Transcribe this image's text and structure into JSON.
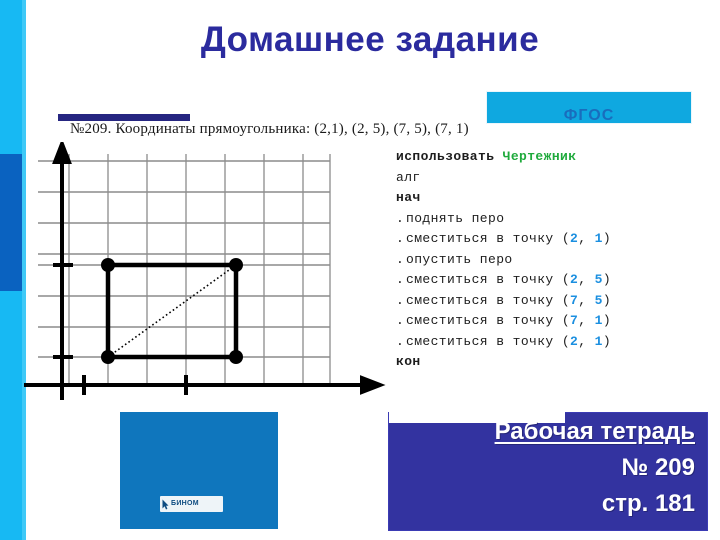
{
  "slide": {
    "title": "Домашнее задание",
    "caption": "№209. Координаты прямоугольника: (2,1), (2, 5), (7, 5), (7, 1)",
    "badge": {
      "text": "ФГОС",
      "color": "#0fa8e0"
    },
    "accent_colors": {
      "title": "#2b2b9e",
      "strip_cyan": "#17b9f3",
      "strip_dark": "#0a62c0",
      "navy_rule": "#262681",
      "panel": "#3333a0",
      "publisher_box": "#0f76bd",
      "keyword_green": "#1faa3c",
      "number_blue": "#1b8fe0"
    }
  },
  "code": {
    "lines": [
      {
        "bullet": false,
        "bold": true,
        "text": "использовать ",
        "object": "Чертежник"
      },
      {
        "bullet": false,
        "bold": false,
        "text": "алг"
      },
      {
        "bullet": false,
        "bold": true,
        "text": "нач"
      },
      {
        "bullet": true,
        "bold": false,
        "text": "поднять перо"
      },
      {
        "bullet": true,
        "bold": false,
        "text": "сместиться в точку ",
        "open": "(",
        "x": "2",
        "sep": ", ",
        "y": "1",
        "close": ")"
      },
      {
        "bullet": true,
        "bold": false,
        "text": "опустить перо"
      },
      {
        "bullet": true,
        "bold": false,
        "text": "сместиться в точку ",
        "open": "(",
        "x": "2",
        "sep": ", ",
        "y": "5",
        "close": ")"
      },
      {
        "bullet": true,
        "bold": false,
        "text": "сместиться в точку ",
        "open": "(",
        "x": "7",
        "sep": ", ",
        "y": "5",
        "close": ")"
      },
      {
        "bullet": true,
        "bold": false,
        "text": "сместиться в точку ",
        "open": "(",
        "x": "7",
        "sep": ", ",
        "y": "1",
        "close": ")"
      },
      {
        "bullet": true,
        "bold": false,
        "text": "сместиться в точку ",
        "open": "(",
        "x": "2",
        "sep": ", ",
        "y": "1",
        "close": ")"
      },
      {
        "bullet": false,
        "bold": true,
        "text": "кон"
      }
    ]
  },
  "chart_data": {
    "type": "scatter",
    "title": "",
    "xlabel": "",
    "ylabel": "",
    "grid": true,
    "legend": "none",
    "xlim": [
      0,
      9
    ],
    "ylim": [
      0,
      8
    ],
    "xticks": [
      2,
      7
    ],
    "yticks": [
      1,
      5
    ],
    "points": [
      {
        "x": 2,
        "y": 5,
        "label": "(2, 5)"
      },
      {
        "x": 7,
        "y": 5,
        "label": "(7, 5)"
      },
      {
        "x": 7,
        "y": 1,
        "label": "(7, 1)"
      },
      {
        "x": 2,
        "y": 1,
        "label": "(2, 1)"
      }
    ],
    "shapes": [
      {
        "kind": "rectangle",
        "style": "solid",
        "vertices": [
          [
            2,
            1
          ],
          [
            2,
            5
          ],
          [
            7,
            5
          ],
          [
            7,
            1
          ]
        ]
      },
      {
        "kind": "segment",
        "style": "dotted",
        "from": [
          2,
          1
        ],
        "to": [
          7,
          5
        ]
      }
    ]
  },
  "publisher": {
    "name": "БИНОМ",
    "logo_icon": "cursor-arrow-icon"
  },
  "notebook": {
    "line1": "Рабочая тетрадь",
    "line2": "№ 209",
    "line3": "стр. 181"
  }
}
